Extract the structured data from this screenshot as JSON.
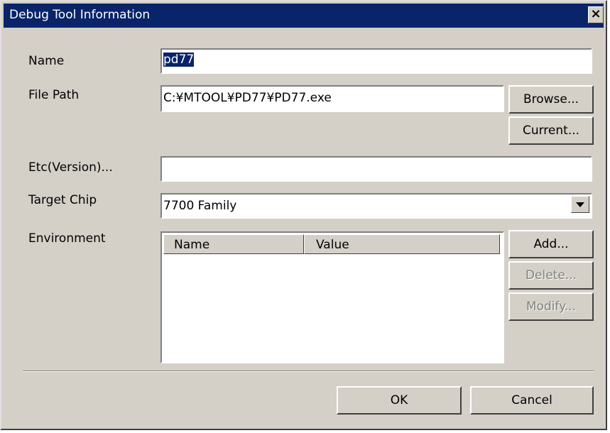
{
  "window": {
    "title": "Debug Tool Information",
    "close_glyph": "×"
  },
  "fields": {
    "name_label": "Name",
    "name_selected": "pd77",
    "filepath_label": "File Path",
    "filepath_value": "C:¥MTOOL¥PD77¥PD77.exe",
    "etc_label": "Etc(Version)...",
    "etc_value": "",
    "target_label": "Target Chip",
    "target_value": "7700 Family",
    "env_label": "Environment"
  },
  "buttons": {
    "browse": "Browse...",
    "current": "Current...",
    "add": "Add...",
    "delete": "Delete...",
    "modify": "Modify...",
    "ok": "OK",
    "cancel": "Cancel"
  },
  "env_table": {
    "columns": [
      "Name",
      "Value"
    ],
    "rows": []
  },
  "colors": {
    "titlebar": "#0a246a",
    "face": "#d4d0c8",
    "disabled_text": "#808080"
  }
}
